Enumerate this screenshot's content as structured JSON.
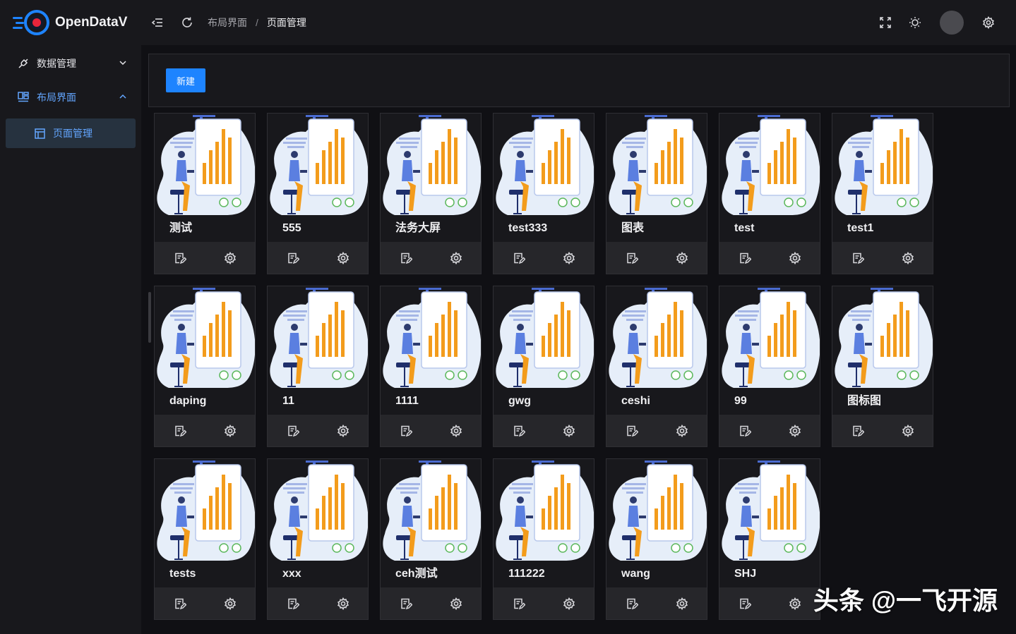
{
  "brand": {
    "name": "OpenDataV",
    "accent": "#e8253b",
    "ring": "#1e84ff"
  },
  "header": {
    "breadcrumb": [
      "布局界面",
      "页面管理"
    ],
    "separator": "/"
  },
  "sidebar": {
    "items": [
      {
        "label": "数据管理",
        "icon": "plug-icon",
        "expanded": false
      },
      {
        "label": "布局界面",
        "icon": "layout-icon",
        "expanded": true,
        "children": [
          {
            "label": "页面管理",
            "icon": "panel-icon",
            "active": true
          }
        ]
      }
    ]
  },
  "toolbar": {
    "new_label": "新建"
  },
  "colors": {
    "primary": "#1e84ff",
    "active_text": "#63a6ff",
    "bar": "#f39c1c"
  },
  "cards": [
    {
      "title": "测试"
    },
    {
      "title": "555"
    },
    {
      "title": "法务大屏"
    },
    {
      "title": "test333"
    },
    {
      "title": "图表"
    },
    {
      "title": "test"
    },
    {
      "title": "test1"
    },
    {
      "title": "daping"
    },
    {
      "title": "11"
    },
    {
      "title": "1111"
    },
    {
      "title": "gwg"
    },
    {
      "title": "ceshi"
    },
    {
      "title": "99"
    },
    {
      "title": "图标图"
    },
    {
      "title": "tests"
    },
    {
      "title": "xxx"
    },
    {
      "title": "ceh测试"
    },
    {
      "title": "111222"
    },
    {
      "title": "wang"
    },
    {
      "title": "SHJ"
    }
  ],
  "watermark": "头条 @一飞开源"
}
